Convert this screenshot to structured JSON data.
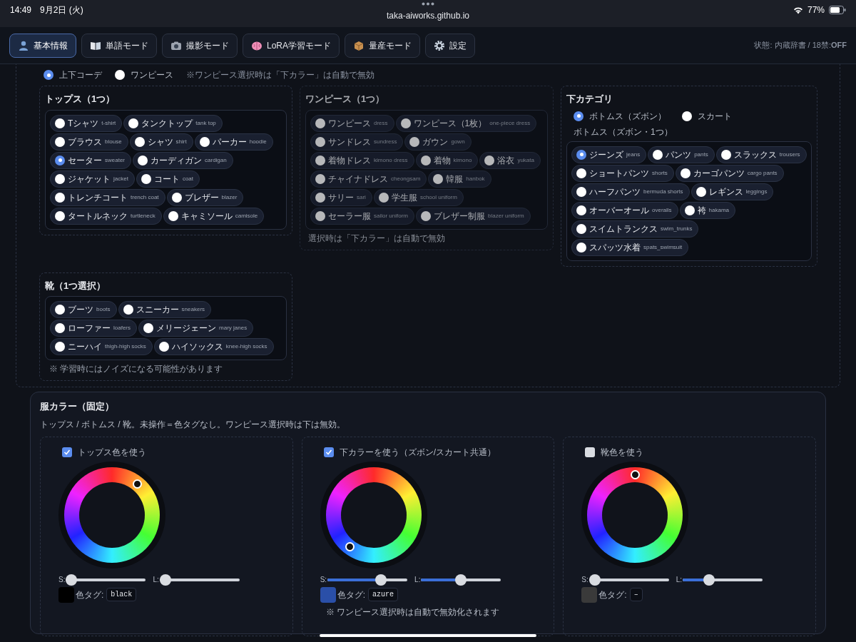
{
  "status_bar": {
    "time": "14:49",
    "date": "9月2日 (火)",
    "url": "taka-aiworks.github.io",
    "battery": "77%"
  },
  "nav": {
    "tabs": [
      {
        "label": "基本情報",
        "selected": true
      },
      {
        "label": "単語モード",
        "selected": false
      },
      {
        "label": "撮影モード",
        "selected": false
      },
      {
        "label": "LoRA学習モード",
        "selected": false
      },
      {
        "label": "量産モード",
        "selected": false
      },
      {
        "label": "設定",
        "selected": false
      }
    ],
    "status": "状態: 内蔵辞書 / 18禁:**OFF**"
  },
  "outfit_mode": {
    "options": [
      {
        "label": "上下コーデ",
        "selected": true
      },
      {
        "label": "ワンピース",
        "selected": false
      }
    ],
    "note": "※ワンピース選択時は「下カラー」は自動で無効"
  },
  "tops": {
    "title": "トップス（1つ）",
    "items": [
      {
        "ja": "Tシャツ",
        "en": "t-shirt",
        "selected": false
      },
      {
        "ja": "タンクトップ",
        "en": "tank top",
        "selected": false
      },
      {
        "ja": "ブラウス",
        "en": "blouse",
        "selected": false
      },
      {
        "ja": "シャツ",
        "en": "shirt",
        "selected": false
      },
      {
        "ja": "パーカー",
        "en": "hoodie",
        "selected": false
      },
      {
        "ja": "セーター",
        "en": "sweater",
        "selected": true
      },
      {
        "ja": "カーディガン",
        "en": "cardigan",
        "selected": false
      },
      {
        "ja": "ジャケット",
        "en": "jacket",
        "selected": false
      },
      {
        "ja": "コート",
        "en": "coat",
        "selected": false
      },
      {
        "ja": "トレンチコート",
        "en": "trench coat",
        "selected": false
      },
      {
        "ja": "ブレザー",
        "en": "blazer",
        "selected": false
      },
      {
        "ja": "タートルネック",
        "en": "turtleneck",
        "selected": false
      },
      {
        "ja": "キャミソール",
        "en": "camisole",
        "selected": false
      }
    ]
  },
  "one_piece": {
    "title": "ワンピース（1つ）",
    "disabled": true,
    "items": [
      {
        "ja": "ワンピース",
        "en": "dress",
        "selected": false
      },
      {
        "ja": "ワンピース（1枚）",
        "en": "one-piece dress",
        "selected": false
      },
      {
        "ja": "サンドレス",
        "en": "sundress",
        "selected": false
      },
      {
        "ja": "ガウン",
        "en": "gown",
        "selected": false
      },
      {
        "ja": "着物ドレス",
        "en": "kimono dress",
        "selected": false
      },
      {
        "ja": "着物",
        "en": "kimono",
        "selected": false
      },
      {
        "ja": "浴衣",
        "en": "yukata",
        "selected": false
      },
      {
        "ja": "チャイナドレス",
        "en": "cheongsam",
        "selected": false
      },
      {
        "ja": "韓服",
        "en": "hanbok",
        "selected": false
      },
      {
        "ja": "サリー",
        "en": "sari",
        "selected": false
      },
      {
        "ja": "学生服",
        "en": "school uniform",
        "selected": false
      },
      {
        "ja": "セーラー服",
        "en": "sailor uniform",
        "selected": false
      },
      {
        "ja": "ブレザー制服",
        "en": "blazer uniform",
        "selected": false
      }
    ],
    "note": "選択時は「下カラー」は自動で無効"
  },
  "bottom_category": {
    "title": "下カテゴリ",
    "options": [
      {
        "label": "ボトムス（ズボン）",
        "selected": true
      },
      {
        "label": "スカート",
        "selected": false
      }
    ],
    "subtitle": "ボトムス（ズボン・1つ）",
    "items": [
      {
        "ja": "ジーンズ",
        "en": "jeans",
        "selected": true
      },
      {
        "ja": "パンツ",
        "en": "pants",
        "selected": false
      },
      {
        "ja": "スラックス",
        "en": "trousers",
        "selected": false
      },
      {
        "ja": "ショートパンツ",
        "en": "shorts",
        "selected": false
      },
      {
        "ja": "カーゴパンツ",
        "en": "cargo pants",
        "selected": false
      },
      {
        "ja": "ハーフパンツ",
        "en": "bermuda shorts",
        "selected": false
      },
      {
        "ja": "レギンス",
        "en": "leggings",
        "selected": false
      },
      {
        "ja": "オーバーオール",
        "en": "overalls",
        "selected": false
      },
      {
        "ja": "袴",
        "en": "hakama",
        "selected": false
      },
      {
        "ja": "スイムトランクス",
        "en": "swim_trunks",
        "selected": false
      },
      {
        "ja": "スパッツ水着",
        "en": "spats_swimsuit",
        "selected": false
      }
    ]
  },
  "shoes": {
    "title": "靴（1つ選択）",
    "items": [
      {
        "ja": "ブーツ",
        "en": "boots",
        "selected": false
      },
      {
        "ja": "スニーカー",
        "en": "sneakers",
        "selected": false
      },
      {
        "ja": "ローファー",
        "en": "loafers",
        "selected": false
      },
      {
        "ja": "メリージェーン",
        "en": "mary janes",
        "selected": false
      },
      {
        "ja": "ニーハイ",
        "en": "thigh-high socks",
        "selected": false
      },
      {
        "ja": "ハイソックス",
        "en": "knee-high socks",
        "selected": false
      }
    ],
    "note": "※ 学習時にはノイズになる可能性があります"
  },
  "clothing_color": {
    "title": "服カラー（固定）",
    "description": "トップス / ボトムス / 靴。未操作＝色タグなし。ワンピース選択時は下は無効。",
    "pickers": [
      {
        "label": "トップス色を使う",
        "checked": true,
        "s_label": "S:",
        "saturation": {
          "level": 0
        },
        "l_label": "L:",
        "lightness": {
          "level": 0
        },
        "color": "#000000",
        "tag_label": "色タグ:",
        "tag": "black"
      },
      {
        "label": "下カラーを使う（ズボン/スカート共通）",
        "checked": true,
        "s_label": "S:",
        "saturation": {
          "level": 0.7
        },
        "l_label": "L:",
        "lightness": {
          "level": 0.5
        },
        "color": "#2a4fa8",
        "tag_label": "色タグ:",
        "tag": "azure",
        "note": "※ ワンピース選択時は自動で無効化されます"
      },
      {
        "label": "靴色を使う",
        "checked": false,
        "s_label": "S:",
        "saturation": {
          "level": 0
        },
        "l_label": "L:",
        "lightness": {
          "level": 0.3
        },
        "color": "#3a3a3a",
        "tag_label": "色タグ:",
        "tag": "–"
      }
    ]
  }
}
